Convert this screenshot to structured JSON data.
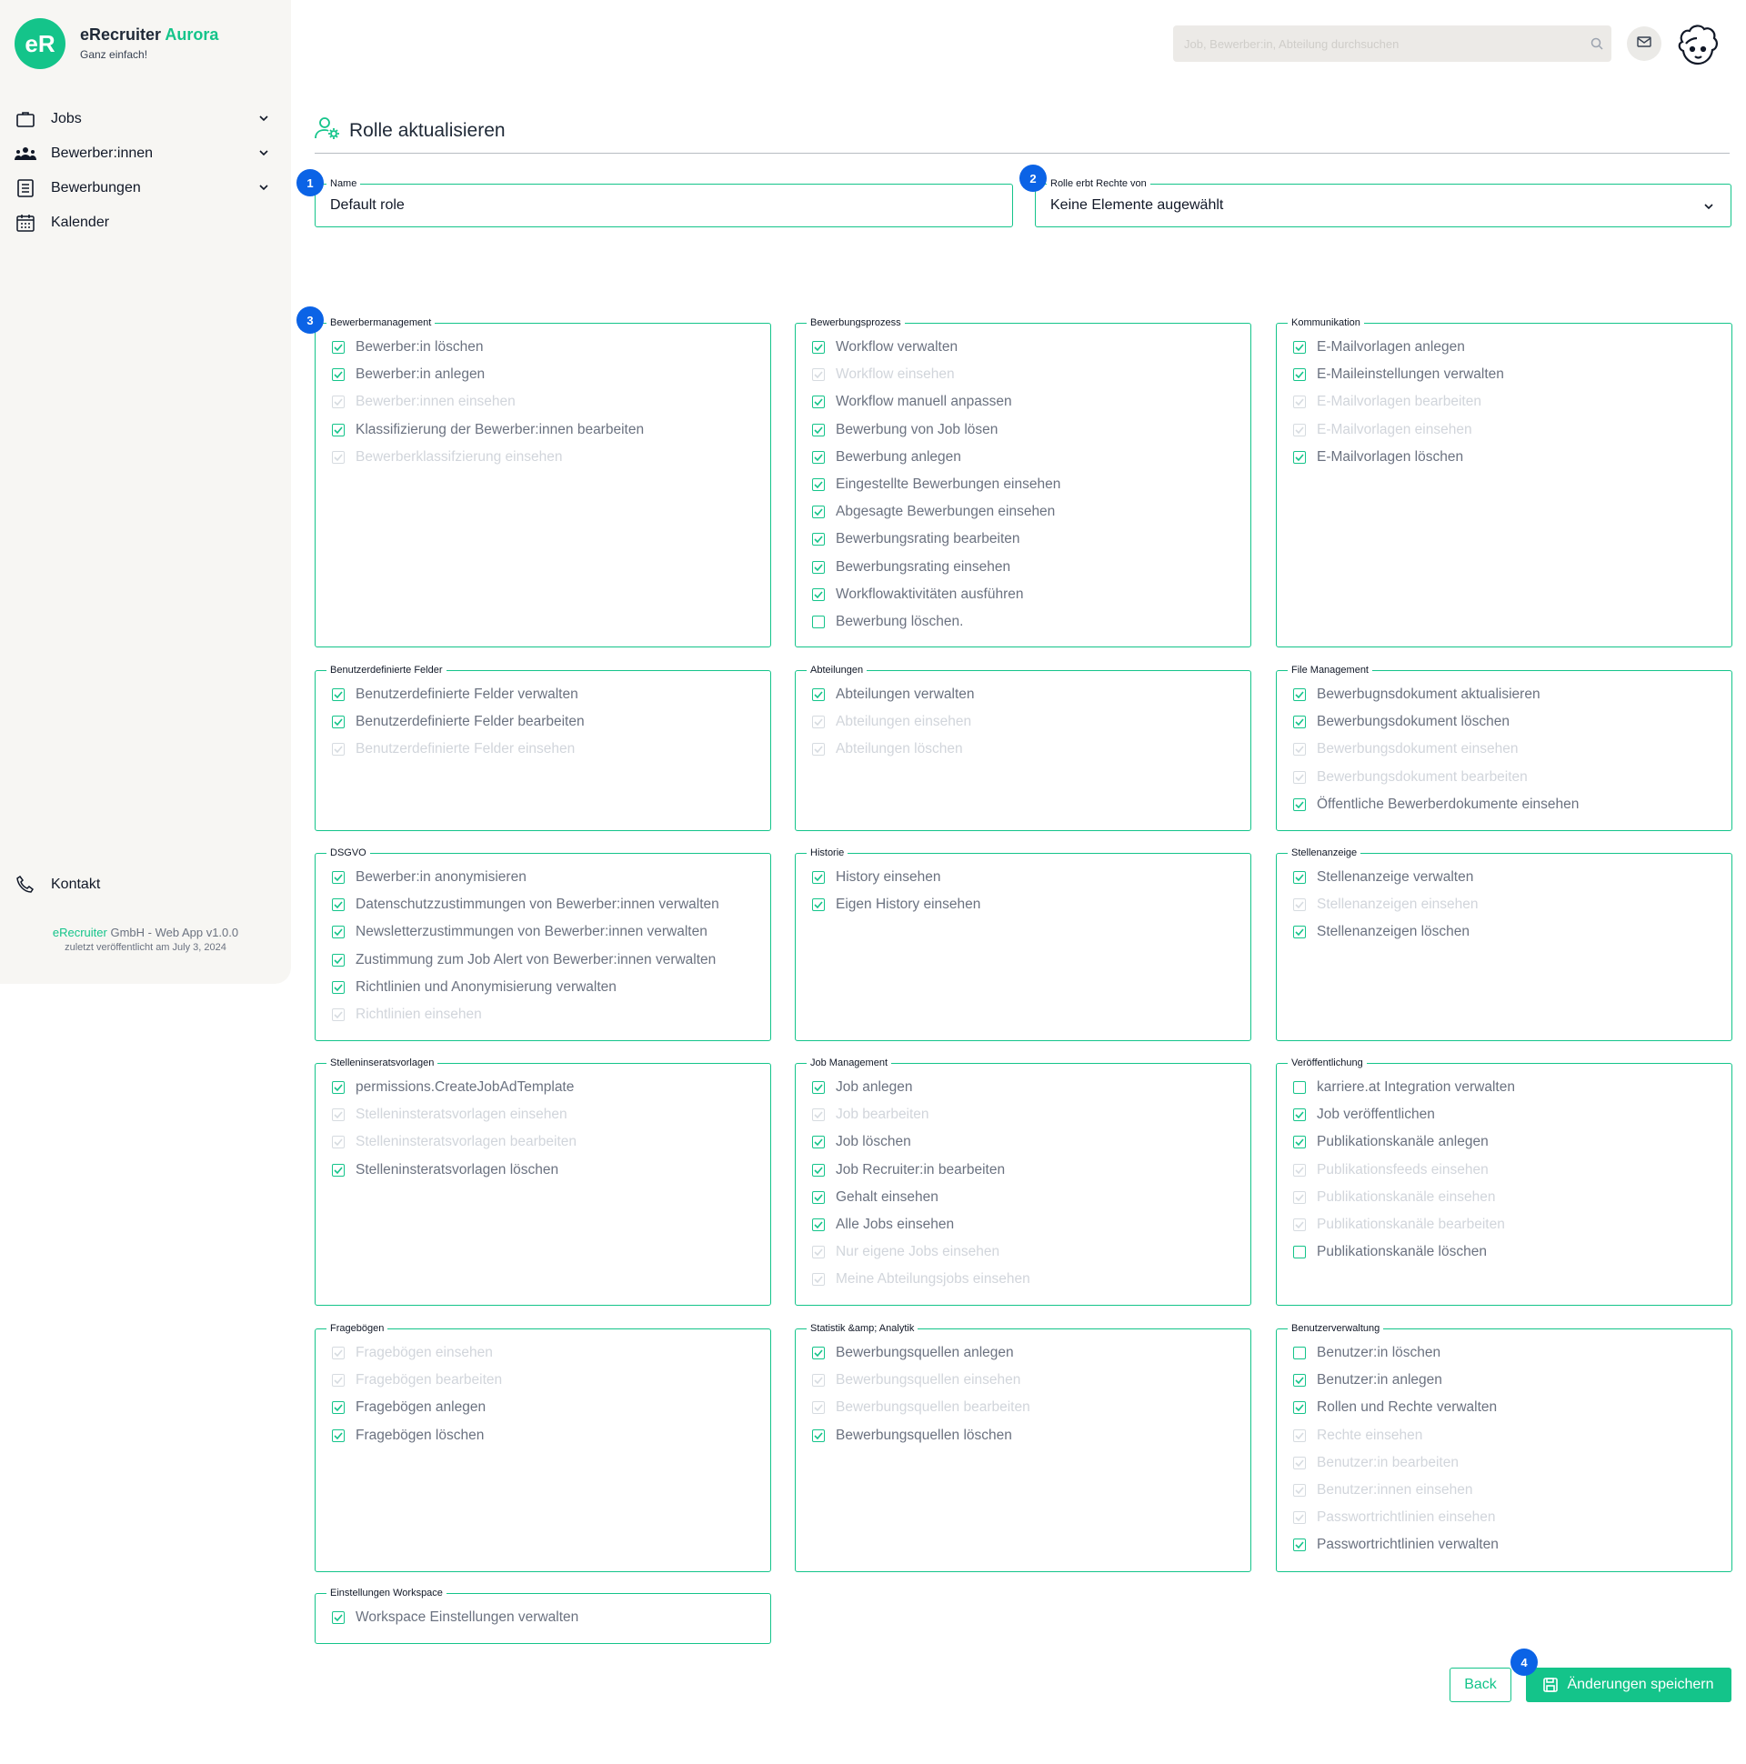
{
  "app": {
    "brand_main": "eRecruiter",
    "brand_accent": "Aurora",
    "logo_text": "eR",
    "tagline": "Ganz einfach!",
    "accent_color": "#14c48a",
    "step_color": "#0b63e6"
  },
  "sidebar": {
    "items": [
      {
        "label": "Jobs",
        "icon": "briefcase-icon",
        "expandable": true
      },
      {
        "label": "Bewerber:innen",
        "icon": "people-icon",
        "expandable": true
      },
      {
        "label": "Bewerbungen",
        "icon": "document-list-icon",
        "expandable": true
      },
      {
        "label": "Kalender",
        "icon": "calendar-icon",
        "expandable": false
      }
    ],
    "contact_label": "Kontakt",
    "footer": {
      "company_accent": "eRecruiter",
      "company_rest": " GmbH - Web App v1.0.0",
      "published": "zuletzt veröffentlicht am July 3, 2024"
    }
  },
  "header": {
    "search_placeholder": "Job, Bewerber:in, Abteilung durchsuchen"
  },
  "page": {
    "title": "Rolle aktualisieren",
    "steps": [
      "1",
      "2",
      "3",
      "4"
    ],
    "name_field": {
      "label": "Name",
      "value": "Default role"
    },
    "inherit_field": {
      "label": "Rolle erbt Rechte von",
      "value": "Keine Elemente augewählt"
    },
    "back_label": "Back",
    "save_label": "Änderungen speichern"
  },
  "groups": [
    {
      "title": "Bewerbermanagement",
      "items": [
        {
          "label": "Bewerber:in löschen",
          "checked": true,
          "disabled": false
        },
        {
          "label": "Bewerber:in anlegen",
          "checked": true,
          "disabled": false
        },
        {
          "label": "Bewerber:innen einsehen",
          "checked": true,
          "disabled": true
        },
        {
          "label": "Klassifizierung der Bewerber:innen bearbeiten",
          "checked": true,
          "disabled": false
        },
        {
          "label": "Bewerberklassifzierung einsehen",
          "checked": true,
          "disabled": true
        }
      ]
    },
    {
      "title": "Bewerbungsprozess",
      "items": [
        {
          "label": "Workflow verwalten",
          "checked": true,
          "disabled": false
        },
        {
          "label": "Workflow einsehen",
          "checked": true,
          "disabled": true
        },
        {
          "label": "Workflow manuell anpassen",
          "checked": true,
          "disabled": false
        },
        {
          "label": "Bewerbung von Job lösen",
          "checked": true,
          "disabled": false
        },
        {
          "label": "Bewerbung anlegen",
          "checked": true,
          "disabled": false
        },
        {
          "label": "Eingestellte Bewerbungen einsehen",
          "checked": true,
          "disabled": false
        },
        {
          "label": "Abgesagte Bewerbungen einsehen",
          "checked": true,
          "disabled": false
        },
        {
          "label": "Bewerbungsrating bearbeiten",
          "checked": true,
          "disabled": false
        },
        {
          "label": "Bewerbungsrating einsehen",
          "checked": true,
          "disabled": false
        },
        {
          "label": "Workflowaktivitäten ausführen",
          "checked": true,
          "disabled": false
        },
        {
          "label": "Bewerbung löschen.",
          "checked": false,
          "disabled": false
        }
      ]
    },
    {
      "title": "Kommunikation",
      "items": [
        {
          "label": "E-Mailvorlagen anlegen",
          "checked": true,
          "disabled": false
        },
        {
          "label": "E-Maileinstellungen verwalten",
          "checked": true,
          "disabled": false
        },
        {
          "label": "E-Mailvorlagen bearbeiten",
          "checked": true,
          "disabled": true
        },
        {
          "label": "E-Mailvorlagen einsehen",
          "checked": true,
          "disabled": true
        },
        {
          "label": "E-Mailvorlagen löschen",
          "checked": true,
          "disabled": false
        }
      ]
    },
    {
      "title": "Benutzerdefinierte Felder",
      "items": [
        {
          "label": "Benutzerdefinierte Felder verwalten",
          "checked": true,
          "disabled": false
        },
        {
          "label": "Benutzerdefinierte Felder bearbeiten",
          "checked": true,
          "disabled": false
        },
        {
          "label": "Benutzerdefinierte Felder einsehen",
          "checked": true,
          "disabled": true
        }
      ]
    },
    {
      "title": "Abteilungen",
      "items": [
        {
          "label": "Abteilungen verwalten",
          "checked": true,
          "disabled": false
        },
        {
          "label": "Abteilungen einsehen",
          "checked": true,
          "disabled": true
        },
        {
          "label": "Abteilungen löschen",
          "checked": true,
          "disabled": true
        }
      ]
    },
    {
      "title": "File Management",
      "items": [
        {
          "label": "Bewerbugnsdokument aktualisieren",
          "checked": true,
          "disabled": false
        },
        {
          "label": "Bewerbungsdokument löschen",
          "checked": true,
          "disabled": false
        },
        {
          "label": "Bewerbungsdokument einsehen",
          "checked": true,
          "disabled": true
        },
        {
          "label": "Bewerbungsdokument bearbeiten",
          "checked": true,
          "disabled": true
        },
        {
          "label": "Öffentliche Bewerberdokumente einsehen",
          "checked": true,
          "disabled": false
        }
      ]
    },
    {
      "title": "DSGVO",
      "items": [
        {
          "label": "Bewerber:in anonymisieren",
          "checked": true,
          "disabled": false
        },
        {
          "label": "Datenschutzzustimmungen von Bewerber:innen verwalten",
          "checked": true,
          "disabled": false
        },
        {
          "label": "Newsletterzustimmungen von Bewerber:innen verwalten",
          "checked": true,
          "disabled": false
        },
        {
          "label": "Zustimmung zum Job Alert von Bewerber:innen verwalten",
          "checked": true,
          "disabled": false
        },
        {
          "label": "Richtlinien und Anonymisierung verwalten",
          "checked": true,
          "disabled": false
        },
        {
          "label": "Richtlinien einsehen",
          "checked": true,
          "disabled": true
        }
      ]
    },
    {
      "title": "Historie",
      "items": [
        {
          "label": "History einsehen",
          "checked": true,
          "disabled": false
        },
        {
          "label": "Eigen History einsehen",
          "checked": true,
          "disabled": false
        }
      ]
    },
    {
      "title": "Stellenanzeige",
      "items": [
        {
          "label": "Stellenanzeige verwalten",
          "checked": true,
          "disabled": false
        },
        {
          "label": "Stellenanzeigen einsehen",
          "checked": true,
          "disabled": true
        },
        {
          "label": "Stellenanzeigen löschen",
          "checked": true,
          "disabled": false
        }
      ]
    },
    {
      "title": "Stelleninseratsvorlagen",
      "items": [
        {
          "label": "permissions.CreateJobAdTemplate",
          "checked": true,
          "disabled": false
        },
        {
          "label": "Stelleninsteratsvorlagen einsehen",
          "checked": true,
          "disabled": true
        },
        {
          "label": "Stelleninsteratsvorlagen bearbeiten",
          "checked": true,
          "disabled": true
        },
        {
          "label": "Stelleninsteratsvorlagen löschen",
          "checked": true,
          "disabled": false
        }
      ]
    },
    {
      "title": "Job Management",
      "items": [
        {
          "label": "Job anlegen",
          "checked": true,
          "disabled": false
        },
        {
          "label": "Job bearbeiten",
          "checked": true,
          "disabled": true
        },
        {
          "label": "Job löschen",
          "checked": true,
          "disabled": false
        },
        {
          "label": "Job Recruiter:in bearbeiten",
          "checked": true,
          "disabled": false
        },
        {
          "label": "Gehalt einsehen",
          "checked": true,
          "disabled": false
        },
        {
          "label": "Alle Jobs einsehen",
          "checked": true,
          "disabled": false
        },
        {
          "label": "Nur eigene Jobs einsehen",
          "checked": true,
          "disabled": true
        },
        {
          "label": "Meine Abteilungsjobs einsehen",
          "checked": true,
          "disabled": true
        }
      ]
    },
    {
      "title": "Veröffentlichung",
      "items": [
        {
          "label": "karriere.at Integration verwalten",
          "checked": false,
          "disabled": false
        },
        {
          "label": "Job veröffentlichen",
          "checked": true,
          "disabled": false
        },
        {
          "label": "Publikationskanäle anlegen",
          "checked": true,
          "disabled": false
        },
        {
          "label": "Publikationsfeeds einsehen",
          "checked": true,
          "disabled": true
        },
        {
          "label": "Publikationskanäle einsehen",
          "checked": true,
          "disabled": true
        },
        {
          "label": "Publikationskanäle bearbeiten",
          "checked": true,
          "disabled": true
        },
        {
          "label": "Publikationskanäle löschen",
          "checked": false,
          "disabled": false
        }
      ]
    },
    {
      "title": "Fragebögen",
      "items": [
        {
          "label": "Fragebögen einsehen",
          "checked": true,
          "disabled": true
        },
        {
          "label": "Fragebögen bearbeiten",
          "checked": true,
          "disabled": true
        },
        {
          "label": "Fragebögen anlegen",
          "checked": true,
          "disabled": false
        },
        {
          "label": "Fragebögen löschen",
          "checked": true,
          "disabled": false
        }
      ]
    },
    {
      "title": "Statistik &amp; Analytik",
      "items": [
        {
          "label": "Bewerbungsquellen anlegen",
          "checked": true,
          "disabled": false
        },
        {
          "label": "Bewerbungsquellen einsehen",
          "checked": true,
          "disabled": true
        },
        {
          "label": "Bewerbungsquellen bearbeiten",
          "checked": true,
          "disabled": true
        },
        {
          "label": "Bewerbungsquellen löschen",
          "checked": true,
          "disabled": false
        }
      ]
    },
    {
      "title": "Benutzerverwaltung",
      "items": [
        {
          "label": "Benutzer:in löschen",
          "checked": false,
          "disabled": false
        },
        {
          "label": "Benutzer:in anlegen",
          "checked": true,
          "disabled": false
        },
        {
          "label": "Rollen und Rechte verwalten",
          "checked": true,
          "disabled": false
        },
        {
          "label": "Rechte einsehen",
          "checked": true,
          "disabled": true
        },
        {
          "label": "Benutzer:in bearbeiten",
          "checked": true,
          "disabled": true
        },
        {
          "label": "Benutzer:innen einsehen",
          "checked": true,
          "disabled": true
        },
        {
          "label": "Passwortrichtlinien einsehen",
          "checked": true,
          "disabled": true
        },
        {
          "label": "Passwortrichtlinien verwalten",
          "checked": true,
          "disabled": false
        }
      ]
    },
    {
      "title": "Einstellungen Workspace",
      "items": [
        {
          "label": "Workspace Einstellungen verwalten",
          "checked": true,
          "disabled": false
        }
      ]
    }
  ]
}
